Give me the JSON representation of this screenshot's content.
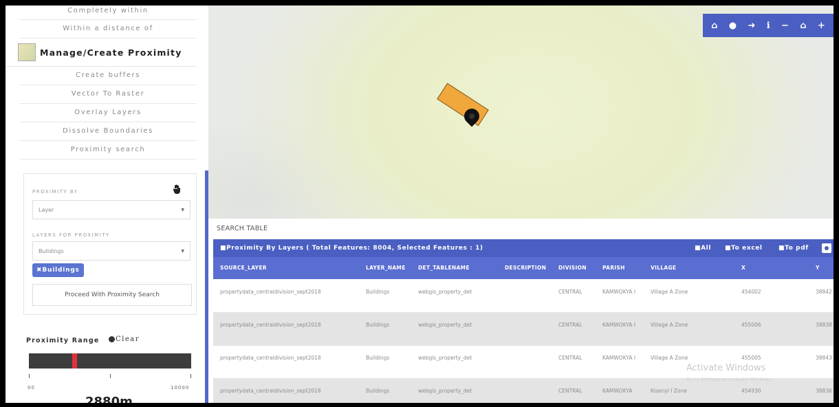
{
  "sidebar": {
    "menu_top": [
      "Completely within",
      "Within a distance of"
    ],
    "section_title": "Manage/Create Proximity",
    "menu_items": [
      "Create buffers",
      "Vector To Raster",
      "Overlay Layers",
      "Dissolve Boundaries",
      "Proximity search"
    ],
    "proximity_by_label": "PROXIMITY BY",
    "proximity_by_value": "Layer",
    "layers_label": "LAYERS FOR PROXIMITY",
    "layers_value": "Buildings",
    "chip_label": "Buildings",
    "proceed_label": "Proceed With Proximity Search",
    "range_label": "Proximity Range",
    "clear_label": "Clear",
    "range_min": "00",
    "range_max": "10000",
    "range_value": "2880m",
    "range_fraction": 0.28
  },
  "map": {
    "toolbar_icons": [
      "⌂",
      "●",
      "➜",
      "ℹ",
      "−",
      "⌂",
      "+"
    ],
    "toolbar_icon_names": [
      "home-icon",
      "location-pin-icon",
      "share-icon",
      "info-icon",
      "zoom-out-icon",
      "home-extent-icon",
      "zoom-in-icon"
    ]
  },
  "table": {
    "section_label": "SEARCH TABLE",
    "title": "Proximity By Layers ( Total Features: 8004, Selected Features : 1)",
    "actions": [
      "All",
      "To excel",
      "To pdf"
    ],
    "columns": [
      "SOURCE_LAYER",
      "LAYER_NAME",
      "DET_TABLENAME",
      "DESCRIPTION",
      "DIVISION",
      "PARISH",
      "VILLAGE",
      "X",
      "Y"
    ],
    "rows": [
      [
        "propertydata_centraldivision_sept2018",
        "Buildings",
        "webgis_property_det",
        "",
        "CENTRAL",
        "KAMWOKYA I",
        "Village A Zone",
        "454002",
        "38842"
      ],
      [
        "propertydata_centraldivision_sept2018",
        "Buildings",
        "webgis_property_det",
        "",
        "CENTRAL",
        "KAMWOKYA I",
        "Village A Zone",
        "455006",
        "38838"
      ],
      [
        "propertydata_centraldivision_sept2018",
        "Buildings",
        "webgis_property_det",
        "",
        "CENTRAL",
        "KAMWOKYA I",
        "Village A Zone",
        "455005",
        "38843"
      ],
      [
        "propertydata_centraldivision_sept2018",
        "Buildings",
        "webgis_property_det",
        "",
        "CENTRAL",
        "KAMWOKYA",
        "Kisenyi I Zone",
        "454930",
        "38836"
      ]
    ]
  },
  "watermark": {
    "line1": "Activate Windows",
    "line2": "Go to Settings to activate Windows."
  },
  "colors": {
    "accent": "#4a5fc1",
    "header": "#5a6dd0",
    "slider_handle": "#e0313a",
    "feature": "#f0a73b"
  }
}
